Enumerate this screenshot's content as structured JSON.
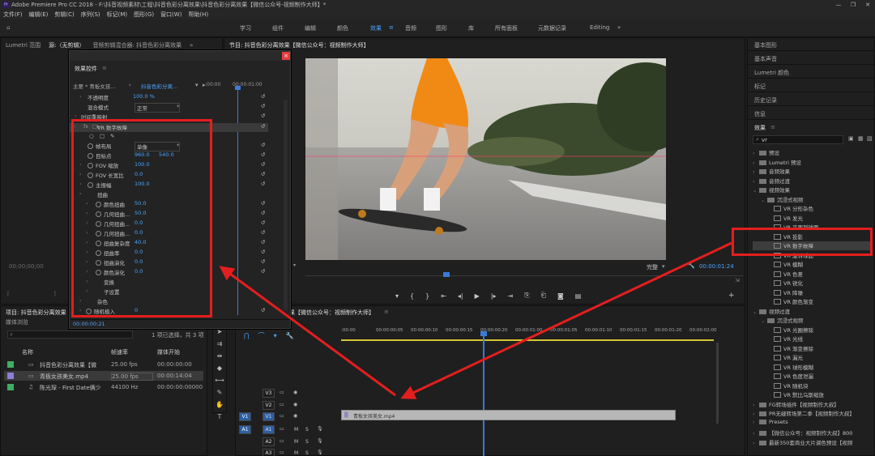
{
  "window": {
    "title": "Adobe Premiere Pro CC 2018 - F:\\抖音视频素材\\工程\\抖音色彩分离效果\\抖音色彩分离效果【微信公众号-视频制作大师】*",
    "min": "—",
    "max": "❐",
    "close": "✕"
  },
  "menu": [
    "文件(F)",
    "编辑(E)",
    "剪辑(C)",
    "序列(S)",
    "标记(M)",
    "图形(G)",
    "窗口(W)",
    "帮助(H)"
  ],
  "workspaces": [
    {
      "label": "学习"
    },
    {
      "label": "组件"
    },
    {
      "label": "编辑"
    },
    {
      "label": "颜色"
    },
    {
      "label": "效果"
    },
    {
      "label": "音频"
    },
    {
      "label": "图形"
    },
    {
      "label": "库"
    },
    {
      "label": "所有面板"
    },
    {
      "label": "元数据记录"
    },
    {
      "label": "Editing"
    }
  ],
  "source_tabs": {
    "lumetri": "Lumetri 范围",
    "source": "源:（无剪辑）",
    "audio_mixer": "音频剪辑混合器: 抖音色彩分离效果",
    "more": "»"
  },
  "program": {
    "title": "节目: 抖音色彩分离效果【微信公众号：视频制作大师】",
    "timecode_right": "00:00:01:24",
    "fit": "完整",
    "left_timecode": "00;00;00;00"
  },
  "effect_controls": {
    "title": "效果控件",
    "close": "×",
    "master_label": "主要 * 青板女孩...",
    "clip_label": "抖音色彩分离...",
    "ruler": [
      ":00:00",
      "00:00:01:00"
    ],
    "rows": [
      {
        "label": "不透明度",
        "value": "100.0 %"
      },
      {
        "label": "混合模式",
        "value": "正常"
      },
      {
        "label": "时间重映射",
        "value": ""
      },
      {
        "label": "VR 数字故障",
        "value": ""
      },
      {
        "label": "",
        "value": ""
      },
      {
        "label": "帧布局",
        "value": "单像"
      },
      {
        "label": "目标点",
        "value": "960.0",
        "value2": "540.0"
      },
      {
        "label": "FOV 缩放",
        "value": "100.0"
      },
      {
        "label": "FOV 长宽比",
        "value": "0.0"
      },
      {
        "label": "主振幅",
        "value": "100.0"
      },
      {
        "label": "扭曲",
        "value": ""
      },
      {
        "label": "颜色扭曲",
        "value": "50.0"
      },
      {
        "label": "几何扭曲...",
        "value": "50.0"
      },
      {
        "label": "几何扭曲...",
        "value": "0.0"
      },
      {
        "label": "几何扭曲...",
        "value": "0.0"
      },
      {
        "label": "扭曲复杂度",
        "value": "40.0"
      },
      {
        "label": "扭曲率",
        "value": "0.0"
      },
      {
        "label": "扭曲演化",
        "value": "0.0"
      },
      {
        "label": "颜色演化",
        "value": "0.0"
      },
      {
        "label": "变换",
        "value": ""
      },
      {
        "label": "子设置",
        "value": ""
      },
      {
        "label": "杂色",
        "value": ""
      },
      {
        "label": "随机植入",
        "value": "0"
      }
    ],
    "footer_time": "00:00:00:21"
  },
  "right_panels": [
    "基本图形",
    "基本声音",
    "Lumetri 颜色",
    "标记",
    "历史记录",
    "信息"
  ],
  "effects_panel": {
    "title": "效果",
    "menu_icon": "≡",
    "search": "vr",
    "rows": [
      {
        "label": "预设",
        "indent": 0,
        "type": "folder"
      },
      {
        "label": "Lumetri 预设",
        "indent": 0,
        "type": "folder"
      },
      {
        "label": "音频效果",
        "indent": 0,
        "type": "folder"
      },
      {
        "label": "音频过渡",
        "indent": 0,
        "type": "folder"
      },
      {
        "label": "视频效果",
        "indent": 0,
        "type": "folder"
      },
      {
        "label": "沉浸式视频",
        "indent": 1,
        "type": "folder"
      },
      {
        "label": "VR 分形杂色",
        "indent": 2,
        "type": "fx"
      },
      {
        "label": "VR 发光",
        "indent": 2,
        "type": "fx"
      },
      {
        "label": "VR 平面到球面",
        "indent": 2,
        "type": "fx"
      },
      {
        "label": "VR 投影",
        "indent": 2,
        "type": "fx"
      },
      {
        "label": "VR 数字故障",
        "indent": 2,
        "type": "fx",
        "selected": true
      },
      {
        "label": "VR 旋转球面",
        "indent": 2,
        "type": "fx"
      },
      {
        "label": "VR 模糊",
        "indent": 2,
        "type": "fx"
      },
      {
        "label": "VR 色差",
        "indent": 2,
        "type": "fx"
      },
      {
        "label": "VR 锐化",
        "indent": 2,
        "type": "fx"
      },
      {
        "label": "VR 降噪",
        "indent": 2,
        "type": "fx"
      },
      {
        "label": "VR 颜色渐变",
        "indent": 2,
        "type": "fx"
      },
      {
        "label": "视频过渡",
        "indent": 0,
        "type": "folder"
      },
      {
        "label": "沉浸式视频",
        "indent": 1,
        "type": "folder"
      },
      {
        "label": "VR 光圈擦除",
        "indent": 2,
        "type": "fx"
      },
      {
        "label": "VR 光线",
        "indent": 2,
        "type": "fx"
      },
      {
        "label": "VR 渐变擦除",
        "indent": 2,
        "type": "fx"
      },
      {
        "label": "VR 漏光",
        "indent": 2,
        "type": "fx"
      },
      {
        "label": "VR 球形模糊",
        "indent": 2,
        "type": "fx"
      },
      {
        "label": "VR 色度泄漏",
        "indent": 2,
        "type": "fx"
      },
      {
        "label": "VR 随机块",
        "indent": 2,
        "type": "fx"
      },
      {
        "label": "VR 默比乌斯缩放",
        "indent": 2,
        "type": "fx"
      },
      {
        "label": "FG转场插件【视频制作大叔】",
        "indent": 0,
        "type": "folder"
      },
      {
        "label": "PR无缝转场第二季【视频制作大叔】",
        "indent": 0,
        "type": "folder"
      },
      {
        "label": "Presets",
        "indent": 0,
        "type": "folder"
      },
      {
        "label": "【微信公众号：视频制作大叔】800",
        "indent": 0,
        "type": "folder"
      },
      {
        "label": "最新350套商业大片调色预设【视频",
        "indent": 0,
        "type": "folder"
      }
    ]
  },
  "project": {
    "title": "项目: 抖音色彩分离效果",
    "tab2": "媒体浏览",
    "folder": "抖音色彩分离效果",
    "count": "1 项已选择，共 3 项",
    "headers": [
      "名称",
      "帧速率",
      "媒体开始"
    ],
    "rows": [
      {
        "name": "抖音色彩分离效果【微",
        "fps": "25.00 fps",
        "start": "00:00:00:00",
        "color": "#3fae62"
      },
      {
        "name": "青板女孩美女.mp4",
        "fps": "25.00 fps",
        "start": "00:00:14:04",
        "color": "#8a7fd9"
      },
      {
        "name": "陈光琛 - First Date俩少",
        "fps": "44100 Hz",
        "start": "00:00:00:00000",
        "color": "#3fae62"
      }
    ]
  },
  "timeline": {
    "title": "抖音色彩分离效果【微信公众号：视频制作大师】",
    "menu": "≡",
    "ruler": [
      ":00:00",
      "00:00:00:05",
      "00:00:00:10",
      "00:00:00:15",
      "00:00:00:20",
      "00:00:01:00",
      "00:00:01:05",
      "00:00:01:10",
      "00:00:01:15",
      "00:00:01:20",
      "00:00:02:00"
    ],
    "tracks": [
      {
        "id": "V3",
        "kind": "v"
      },
      {
        "id": "V2",
        "kind": "v"
      },
      {
        "id": "V1",
        "kind": "v",
        "target": "V1"
      },
      {
        "id": "A1",
        "kind": "a",
        "target": "A1"
      },
      {
        "id": "A2",
        "kind": "a"
      },
      {
        "id": "A3",
        "kind": "a"
      }
    ],
    "clip": "青板女孩美女.mp4",
    "m": "M",
    "s": "S"
  },
  "colors": {
    "accent": "#4aa6ff",
    "annotation": "#e41e1e",
    "clip": "#b7b7b7"
  }
}
